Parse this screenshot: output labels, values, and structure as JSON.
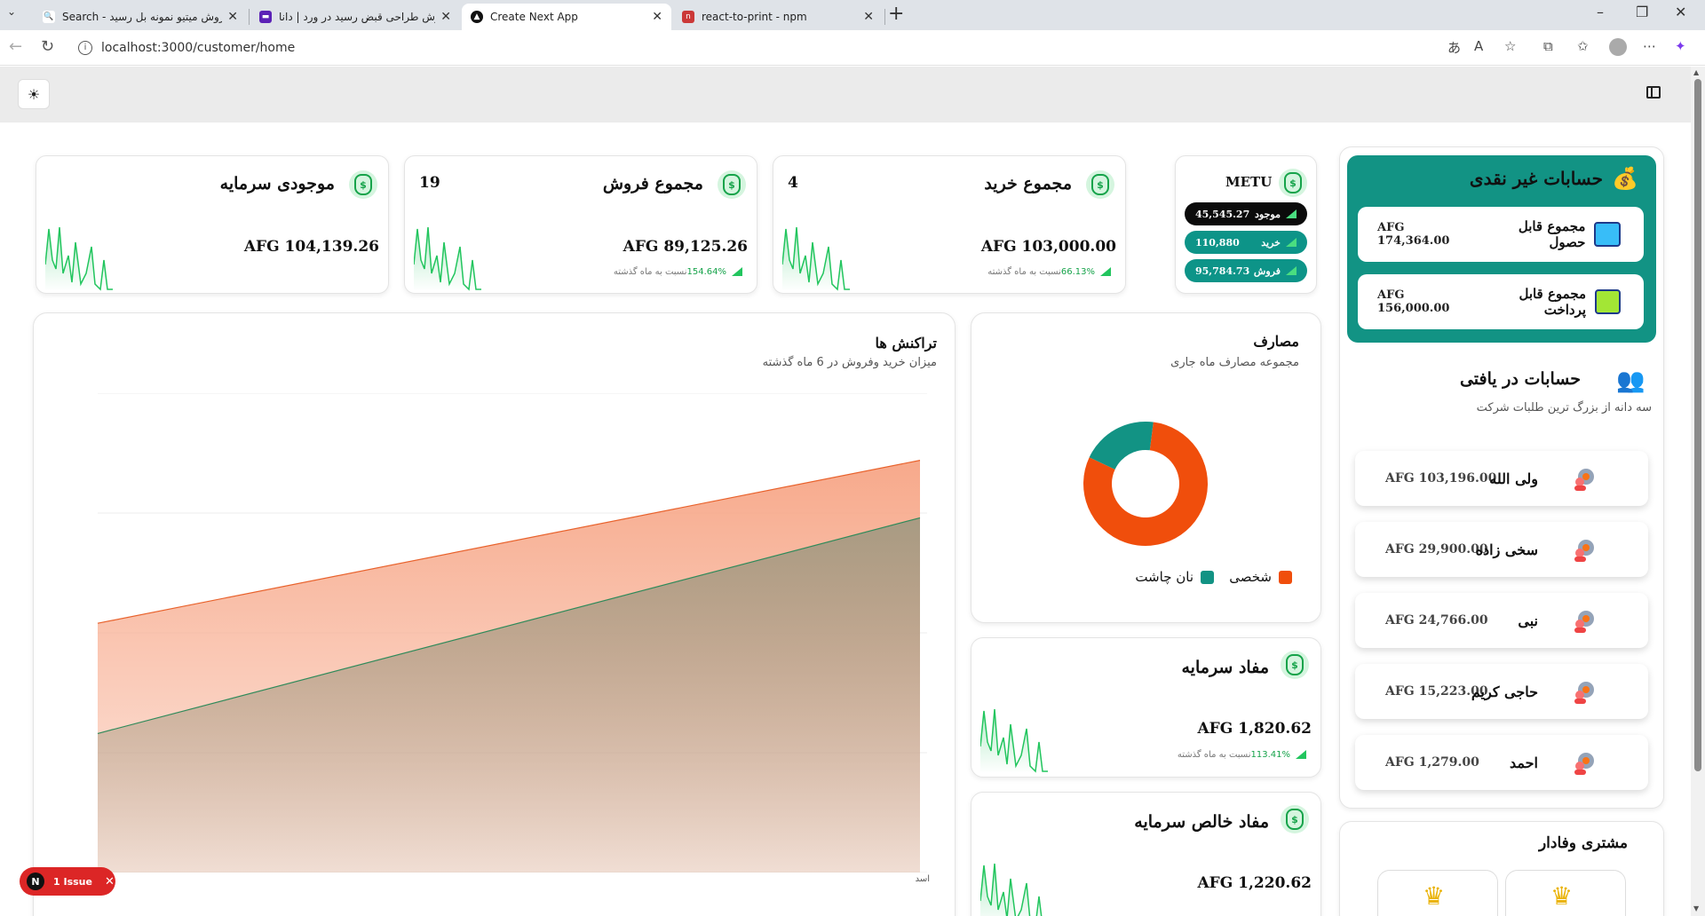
{
  "browser": {
    "tabs": [
      {
        "title": "Search - فروش میتیو نمونه بل رسید",
        "active": false
      },
      {
        "title": "روش طراحی قبض رسید در ورد | دانا",
        "active": false
      },
      {
        "title": "Create Next App",
        "active": true
      },
      {
        "title": "react-to-print - npm",
        "active": false
      }
    ],
    "url": "localhost:3000/customer/home"
  },
  "stats": [
    {
      "title": "موجودی سرمایه",
      "count": "",
      "value": "AFG 104,139.26",
      "pct": "",
      "foot": ""
    },
    {
      "title": "مجموع فروش",
      "count": "19",
      "value": "AFG 89,125.26",
      "pct": "154.64%",
      "foot": "نسبت به ماه گذشته"
    },
    {
      "title": "مجموع خرید",
      "count": "4",
      "value": "AFG 103,000.00",
      "pct": "66.13%",
      "foot": "نسبت به ماه گذشته"
    }
  ],
  "metu": {
    "title": "METU",
    "pills": [
      {
        "label": "موجود",
        "value": "45,545.27",
        "color": "#0b0b0b"
      },
      {
        "label": "خرید",
        "value": "110,880",
        "color": "#0d9488"
      },
      {
        "label": "فروش",
        "value": "95,784.73",
        "color": "#0d9488"
      }
    ]
  },
  "noncash": {
    "title": "حسابات غیر نقدی",
    "color": "#129384",
    "rows": [
      {
        "label": "مجموع قابل حصول",
        "value": "AFG 174,364.00"
      },
      {
        "label": "مجموع قابل پرداخت",
        "value": "AFG 156,000.00"
      }
    ]
  },
  "receivables": {
    "title": "حسابات در یافتی",
    "subtitle": "سه دانه از بزرگ ترین طلبات شرکت",
    "items": [
      {
        "name": "ولی الله",
        "value": "AFG 103,196.00"
      },
      {
        "name": "سخی زاده",
        "value": "AFG 29,900.00"
      },
      {
        "name": "نبی",
        "value": "AFG 24,766.00"
      },
      {
        "name": "حاجی کریم",
        "value": "AFG 15,223.00"
      },
      {
        "name": "احمد",
        "value": "AFG 1,279.00"
      }
    ]
  },
  "loyal": {
    "title": "مشتری وفادار"
  },
  "transactions": {
    "title": "تراکنش ها",
    "subtitle": "میزان خرید وفروش در 6 ماه گذشته",
    "xlabel": "اسد"
  },
  "expenses": {
    "title": "مصارف",
    "subtitle": "مجموعه مصارف ماه جاری",
    "legend": [
      {
        "label": "شخصی",
        "color": "#f04e0c"
      },
      {
        "label": "نان چاشت",
        "color": "#129384"
      }
    ]
  },
  "profit": {
    "title": "مفاد سرمایه",
    "value": "AFG 1,820.62",
    "pct": "113.41%",
    "foot": "نسبت به ماه گذشته"
  },
  "net_profit": {
    "title": "مفاد خالص سرمایه",
    "value": "AFG 1,220.62"
  },
  "issue": {
    "badge": "N",
    "label": "1 Issue"
  },
  "chart_data": [
    {
      "type": "area",
      "title": "تراکنش ها",
      "subtitle": "میزان خرید وفروش در 6 ماه گذشته",
      "categories": [
        "اسد"
      ],
      "series": [
        {
          "color": "#f7a98b",
          "stroke": "#e8622c",
          "values": [
            0.52,
            0.86
          ]
        },
        {
          "color": "#a89b83",
          "stroke": "#2f8a5a",
          "values": [
            0.29,
            0.74
          ]
        }
      ]
    },
    {
      "type": "pie",
      "title": "مصارف",
      "subtitle": "مجموعه مصارف ماه جاری",
      "labels": [
        "شخصی",
        "نان چاشت"
      ],
      "values": [
        80,
        20
      ],
      "colors": [
        "#f04e0c",
        "#129384"
      ]
    }
  ]
}
